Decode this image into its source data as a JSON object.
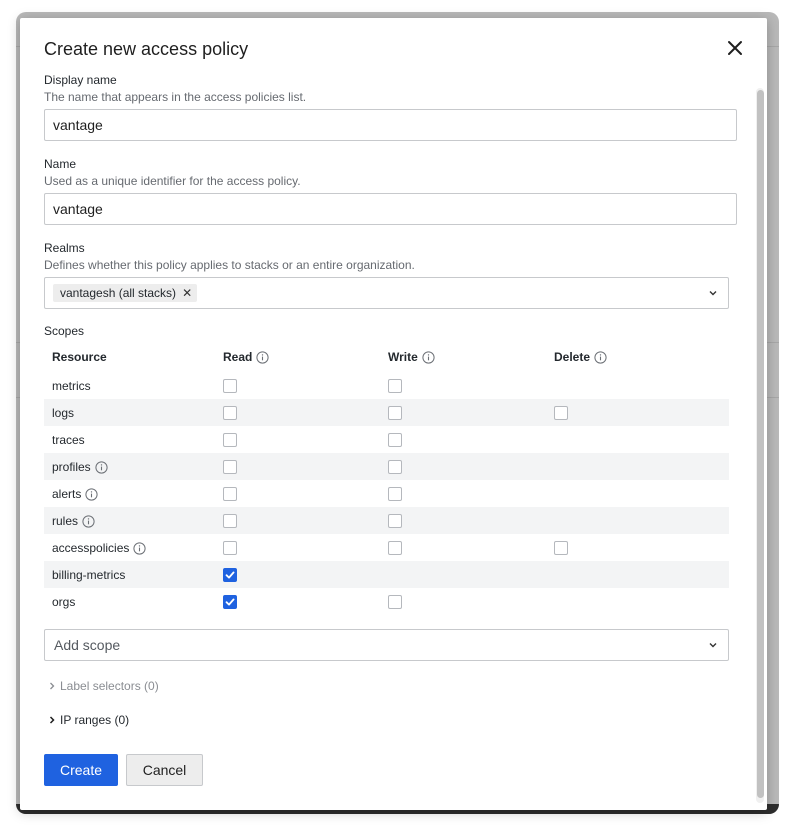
{
  "dialog": {
    "title": "Create new access policy"
  },
  "display_name": {
    "label": "Display name",
    "description": "The name that appears in the access policies list.",
    "value": "vantage"
  },
  "name": {
    "label": "Name",
    "description": "Used as a unique identifier for the access policy.",
    "value": "vantage"
  },
  "realms": {
    "label": "Realms",
    "description": "Defines whether this policy applies to stacks or an entire organization.",
    "selected": [
      "vantagesh (all stacks)"
    ]
  },
  "scopes": {
    "title": "Scopes",
    "columns": [
      "Resource",
      "Read",
      "Write",
      "Delete"
    ],
    "rows": [
      {
        "resource": "metrics",
        "info": false,
        "read": false,
        "write": false,
        "delete": null
      },
      {
        "resource": "logs",
        "info": false,
        "read": false,
        "write": false,
        "delete": false
      },
      {
        "resource": "traces",
        "info": false,
        "read": false,
        "write": false,
        "delete": null
      },
      {
        "resource": "profiles",
        "info": true,
        "read": false,
        "write": false,
        "delete": null
      },
      {
        "resource": "alerts",
        "info": true,
        "read": false,
        "write": false,
        "delete": null
      },
      {
        "resource": "rules",
        "info": true,
        "read": false,
        "write": false,
        "delete": null
      },
      {
        "resource": "accesspolicies",
        "info": true,
        "read": false,
        "write": false,
        "delete": false
      },
      {
        "resource": "billing-metrics",
        "info": false,
        "read": true,
        "write": null,
        "delete": null
      },
      {
        "resource": "orgs",
        "info": false,
        "read": true,
        "write": false,
        "delete": null
      }
    ],
    "add_placeholder": "Add scope"
  },
  "label_selectors": "Label selectors (0)",
  "ip_ranges": "IP ranges (0)",
  "buttons": {
    "create": "Create",
    "cancel": "Cancel"
  },
  "colors": {
    "primary": "#1f62e0",
    "row_alt": "#f3f4f5"
  }
}
